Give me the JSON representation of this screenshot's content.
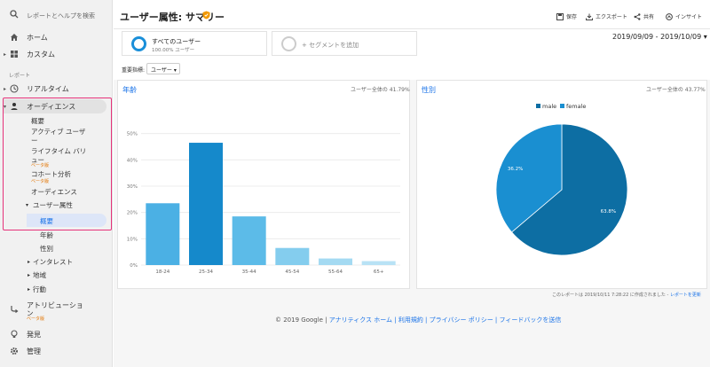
{
  "sidebar": {
    "search_placeholder": "レポートとヘルプを検索",
    "home": "ホーム",
    "custom": "カスタム",
    "reports_section": "レポート",
    "realtime": "リアルタイム",
    "audience": "オーディエンス",
    "audience_items": {
      "overview": "概要",
      "active_users_1": "アクティブ ユーザ",
      "active_users_2": "ー",
      "lifetime_1": "ライフタイム バリ",
      "lifetime_2": "ュー",
      "lifetime_beta": "ベータ版",
      "cohort": "コホート分析",
      "cohort_beta": "ベータ版",
      "audiences": "オーディエンス",
      "demographics": "ユーザー属性",
      "demo_overview": "概要",
      "demo_age": "年齢",
      "demo_gender": "性別",
      "interests": "インタレスト",
      "geo": "地域",
      "behavior": "行動"
    },
    "attribution_1": "アトリビューショ",
    "attribution_2": "ン",
    "attribution_beta": "ベータ版",
    "discover": "発見",
    "admin": "管理"
  },
  "header": {
    "title": "ユーザー属性: サマリー",
    "save": "保存",
    "export": "エクスポート",
    "share": "共有",
    "insights": "インサイト"
  },
  "segments": {
    "all_users": "すべてのユーザー",
    "all_users_pct": "100.00% ユーザー",
    "add_segment": "+ セグメントを追加"
  },
  "date_range": "2019/09/09 - 2019/10/09",
  "metric": {
    "label": "重要指標:",
    "selected": "ユーザー"
  },
  "age_card": {
    "title": "年齢",
    "note": "ユーザー全体の 41.79%"
  },
  "gender_card": {
    "title": "性別",
    "note": "ユーザー全体の 43.77%"
  },
  "chart_data": [
    {
      "type": "bar",
      "title": "年齢",
      "categories": [
        "18-24",
        "25-34",
        "35-44",
        "45-54",
        "55-64",
        "65+"
      ],
      "values": [
        23.5,
        46.5,
        18.5,
        6.5,
        2.5,
        1.5
      ],
      "ylim": [
        0,
        60
      ],
      "yticks": [
        "0%",
        "10%",
        "20%",
        "30%",
        "40%",
        "50%"
      ],
      "colors": [
        "#4bb0e4",
        "#1589cb",
        "#5cbbe8",
        "#84cdee",
        "#a4daf2",
        "#b8e2f5"
      ],
      "grid": true
    },
    {
      "type": "pie",
      "title": "性別",
      "labels": [
        "male",
        "female"
      ],
      "values": [
        63.8,
        36.2
      ],
      "value_labels": [
        "63.8%",
        "36.2%"
      ],
      "colors": [
        "#0d6ea3",
        "#1a8fd1"
      ],
      "legend": "top"
    }
  ],
  "report_note": {
    "text": "このレポートは 2019/10/11 7:28:22 に作成されました - ",
    "link": "レポートを更新"
  },
  "footer": {
    "copyright": "© 2019 Google | ",
    "links": "アナリティクス ホーム | 利用規約 | プライバシー ポリシー | フィードバックを送信"
  }
}
